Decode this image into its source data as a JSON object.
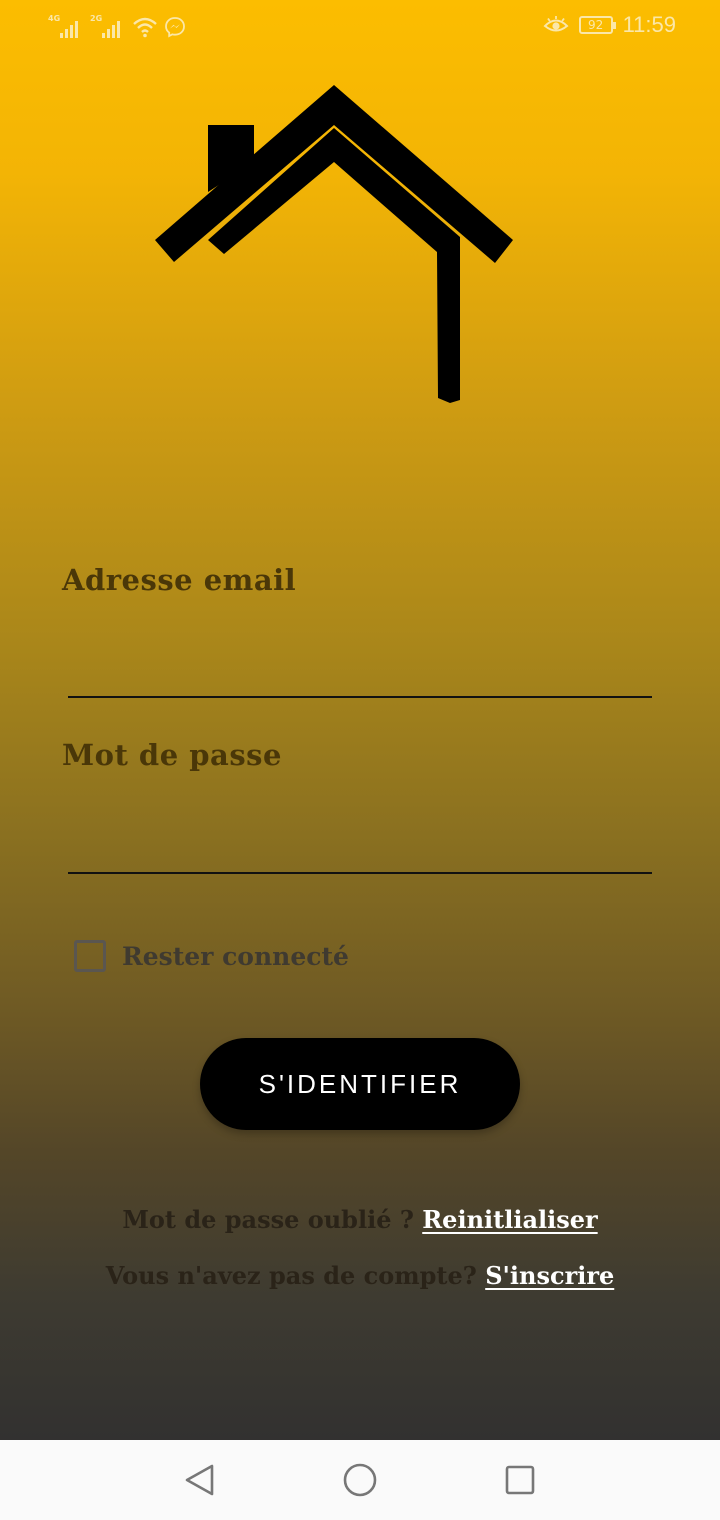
{
  "status_bar": {
    "signal1_tag": "4G",
    "signal2_tag": "2G",
    "battery_level": "92",
    "time": "11:59",
    "icons": [
      "signal-4g-icon",
      "signal-2g-icon",
      "wifi-icon",
      "messenger-icon",
      "eye-comfort-icon",
      "battery-icon"
    ]
  },
  "logo": {
    "icon": "house-icon"
  },
  "form": {
    "email_label": "Adresse email",
    "email_value": "",
    "password_label": "Mot de passe",
    "password_value": "",
    "remember_label": "Rester connecté",
    "remember_checked": false,
    "submit_label": "S'IDENTIFIER"
  },
  "links": {
    "forgot_prefix": "Mot de passe oublié ? ",
    "forgot_link": "Reinitlialiser",
    "signup_prefix": "Vous n'avez pas de compte? ",
    "signup_link": "S'inscrire"
  },
  "nav_bar": {
    "icons": [
      "back-icon",
      "home-icon",
      "recents-icon"
    ]
  },
  "colors": {
    "gradient_top": "#fcbd00",
    "gradient_bottom": "#323130",
    "label_text": "#4a3708",
    "button_bg": "#000000",
    "link_text": "#ffffff"
  }
}
